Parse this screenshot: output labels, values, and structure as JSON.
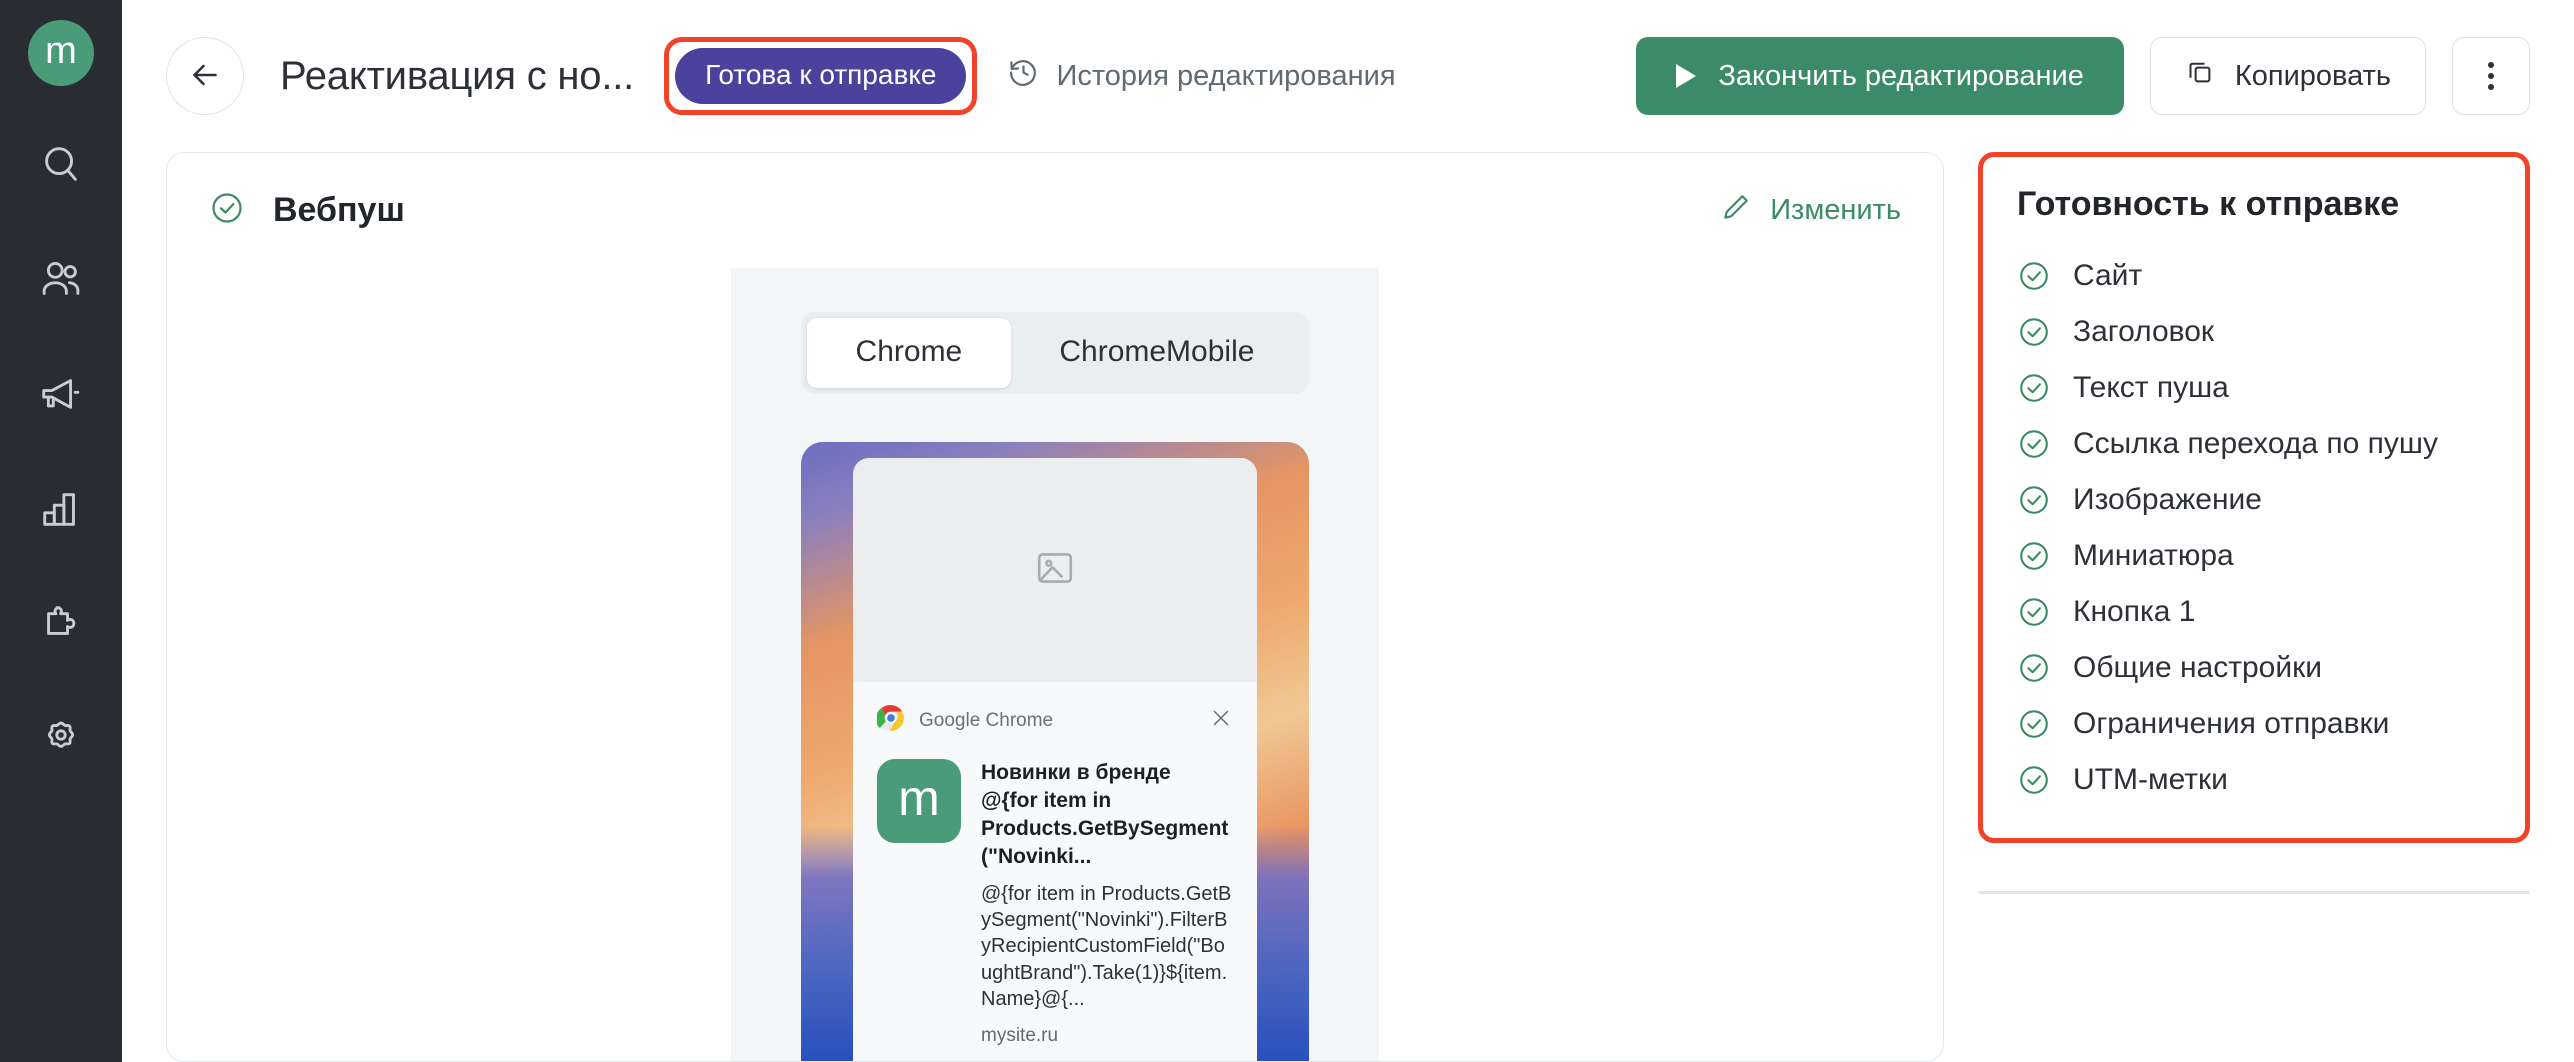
{
  "brand": {
    "logo_letter": "m",
    "logo_color": "#4a9c78"
  },
  "colors": {
    "sidebar_bg": "#292c31",
    "accent_green": "#3b8c66",
    "status_purple": "#4a429c",
    "highlight_red": "#f0432a",
    "text_dark": "#2d3137",
    "text_muted": "#5f6a72"
  },
  "sidebar": {
    "items": [
      {
        "icon": "search-icon",
        "name": "search"
      },
      {
        "icon": "users-icon",
        "name": "customers"
      },
      {
        "icon": "megaphone-icon",
        "name": "campaigns"
      },
      {
        "icon": "bar-chart-icon",
        "name": "analytics"
      },
      {
        "icon": "puzzle-icon",
        "name": "integrations"
      },
      {
        "icon": "gear-icon",
        "name": "settings"
      }
    ]
  },
  "header": {
    "back_icon": "arrow-left-icon",
    "title": "Реактивация с но...",
    "status_badge": "Готова к отправке",
    "history_icon": "clock-rewind-icon",
    "history_label": "История редактирования",
    "primary_button": "Закончить редактирование",
    "primary_icon": "play-icon",
    "copy_button": "Копировать",
    "copy_icon": "copy-icon",
    "more_icon": "kebab-menu-icon"
  },
  "content_card": {
    "status_icon": "check-circle-icon",
    "title": "Вебпуш",
    "edit_icon": "pencil-icon",
    "edit_label": "Изменить",
    "tabs": [
      {
        "label": "Chrome",
        "active": true
      },
      {
        "label": "ChromeMobile",
        "active": false
      }
    ],
    "preview": {
      "image_placeholder_icon": "image-placeholder-icon",
      "app_icon": "chrome-icon",
      "app_name": "Google Chrome",
      "close_icon": "close-icon",
      "avatar_letter": "m",
      "notification_title": "Новинки в бренде @{for item in Products.GetBySegment(\"Novinki...",
      "notification_body": "@{for item in Products.GetBySegment(\"Novinki\").FilterByRecipientCustomField(\"BoughtBrand\").Take(1)}${item.Name}@{...",
      "site": "mysite.ru"
    }
  },
  "readiness": {
    "title": "Готовность к отправке",
    "items": [
      {
        "label": "Сайт",
        "checked": true
      },
      {
        "label": "Заголовок",
        "checked": true
      },
      {
        "label": "Текст пуша",
        "checked": true
      },
      {
        "label": "Ссылка перехода по пушу",
        "checked": true
      },
      {
        "label": "Изображение",
        "checked": true
      },
      {
        "label": "Миниатюра",
        "checked": true
      },
      {
        "label": "Кнопка 1",
        "checked": true
      },
      {
        "label": "Общие настройки",
        "checked": true
      },
      {
        "label": "Ограничения отправки",
        "checked": true
      },
      {
        "label": "UTM-метки",
        "checked": true
      }
    ]
  }
}
